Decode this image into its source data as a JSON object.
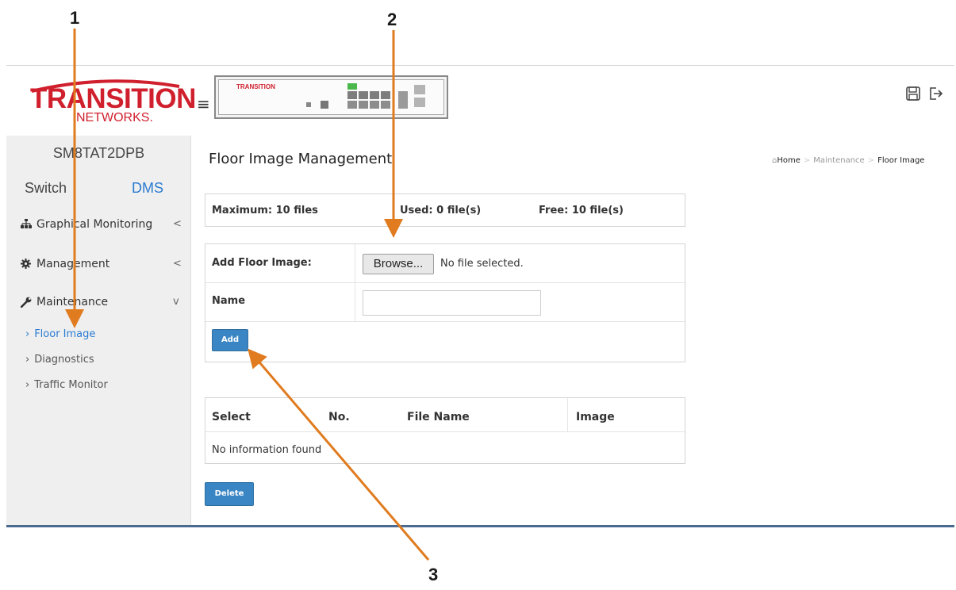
{
  "callouts": [
    "1",
    "2",
    "3"
  ],
  "logo": {
    "main": "TRANSITION",
    "sub": "NETWORKS."
  },
  "sidebar": {
    "device_name": "SM8TAT2DPB",
    "tabs": [
      "Switch",
      "DMS"
    ],
    "items": [
      {
        "label": "Graphical Monitoring",
        "icon": "sitemap-icon",
        "chevron": "<"
      },
      {
        "label": "Management",
        "icon": "gear-icon",
        "chevron": "<"
      },
      {
        "label": "Maintenance",
        "icon": "wrench-icon",
        "chevron": "v"
      }
    ],
    "subitems": [
      "Floor Image",
      "Diagnostics",
      "Traffic Monitor"
    ]
  },
  "header": {
    "menu_icon": "hamburger-icon",
    "device_label": "TRANSITION",
    "actions": [
      "save-icon",
      "logout-icon"
    ]
  },
  "main": {
    "title": "Floor Image Management",
    "breadcrumb": [
      "Home",
      "Maintenance",
      "Floor Image"
    ],
    "stats": {
      "maximum": "Maximum: 10 files",
      "used": "Used: 0 file(s)",
      "free": "Free: 10 file(s)"
    },
    "form": {
      "add_label": "Add Floor Image:",
      "browse_label": "Browse...",
      "file_status": "No file selected.",
      "name_label": "Name",
      "name_value": "",
      "add_button": "Add"
    },
    "table": {
      "headers": [
        "Select",
        "No.",
        "File Name",
        "Image"
      ],
      "empty_message": "No information found"
    },
    "delete_button": "Delete"
  },
  "colors": {
    "accent": "#3a86c4",
    "brand": "#d0202e",
    "annotation": "#e07b1f",
    "link": "#2a7bd1"
  }
}
